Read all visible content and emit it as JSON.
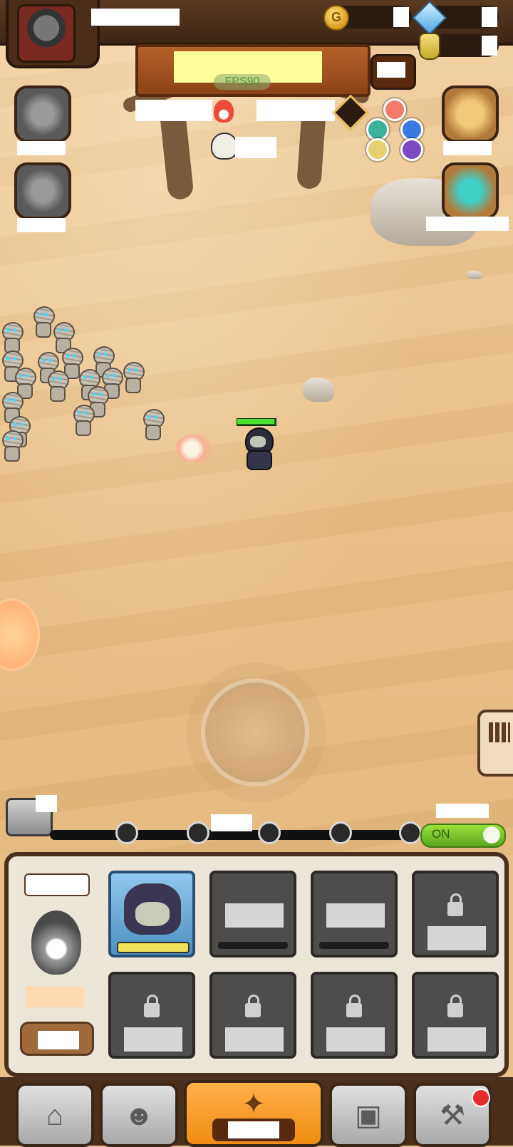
{
  "hud": {
    "fps_label": "FPS90",
    "currency_icons": [
      "gold-coin-icon",
      "gem-icon",
      "potion-icon"
    ]
  },
  "wave": {
    "auto_toggle": "ON"
  },
  "colors": {
    "sand": "#e8c189",
    "wood": "#4a2f1c",
    "banner": "#b5612a",
    "hp_green": "#4be032",
    "toggle_green": "#7cc42a",
    "nav_active": "#f7a22f",
    "badge_red": "#e52d2d"
  },
  "deck": {
    "element_icon": "flame-icon",
    "slots": [
      {
        "state": "hero",
        "icon": "hooded-skull-hero-icon"
      },
      {
        "state": "empty"
      },
      {
        "state": "empty"
      },
      {
        "state": "locked"
      },
      {
        "state": "locked"
      },
      {
        "state": "locked"
      },
      {
        "state": "locked"
      },
      {
        "state": "locked"
      }
    ]
  },
  "nav": [
    "shop-icon",
    "hero-icon",
    "map-compass-icon",
    "inventory-bag-icon",
    "forge-hammer-icon"
  ]
}
